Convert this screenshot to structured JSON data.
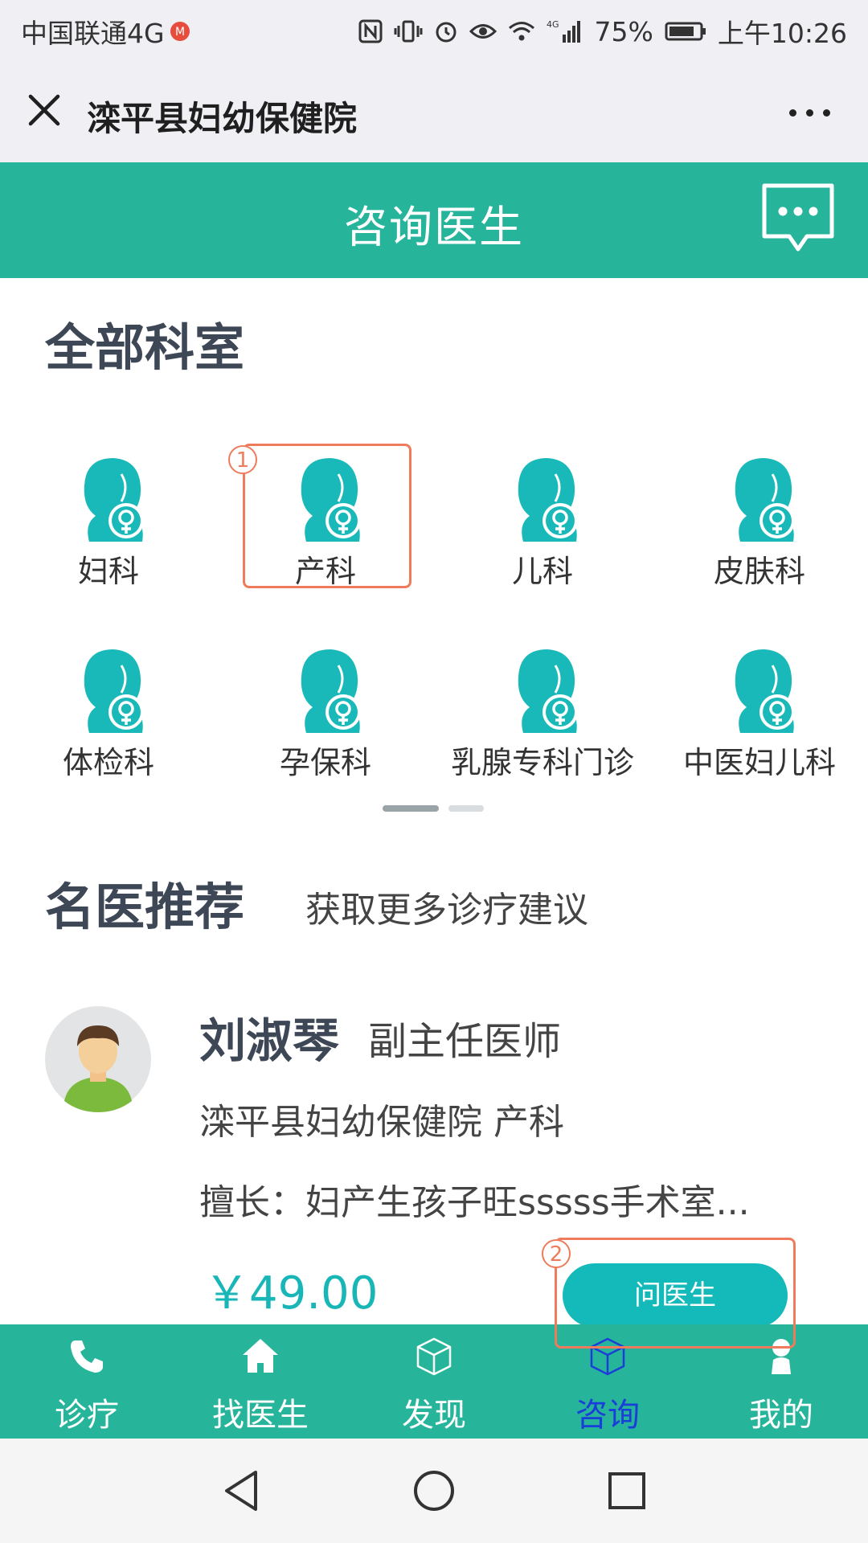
{
  "status_bar": {
    "carrier": "中国联通4G",
    "battery": "75%",
    "time": "上午10:26"
  },
  "title_bar": {
    "title": "滦平县妇幼保健院"
  },
  "header": {
    "title": "咨询医生"
  },
  "departments_section": {
    "title": "全部科室",
    "items": [
      {
        "label": "妇科"
      },
      {
        "label": "产科"
      },
      {
        "label": "儿科"
      },
      {
        "label": "皮肤科"
      },
      {
        "label": "体检科"
      },
      {
        "label": "孕保科"
      },
      {
        "label": "乳腺专科门诊"
      },
      {
        "label": "中医妇儿科"
      }
    ]
  },
  "recommend_section": {
    "title": "名医推荐",
    "subtitle": "获取更多诊疗建议"
  },
  "doctor": {
    "name": "刘淑琴",
    "title": "副主任医师",
    "hospital": "滦平县妇幼保健院 产科",
    "skill": "擅长：妇产生孩子旺sssss手术室...",
    "price": "￥49.00",
    "ask_button": "问医生"
  },
  "annotations": {
    "badge1": "1",
    "badge2": "2"
  },
  "tabs": [
    {
      "label": "诊疗",
      "icon": "phone-icon"
    },
    {
      "label": "找医生",
      "icon": "home-icon"
    },
    {
      "label": "发现",
      "icon": "cube-icon"
    },
    {
      "label": "咨询",
      "icon": "cube-icon",
      "active": true
    },
    {
      "label": "我的",
      "icon": "person-icon"
    }
  ],
  "colors": {
    "primary": "#26b59b",
    "accent_teal": "#13bab9",
    "active_tab": "#1a3fd8",
    "annotation": "#ee7c5c"
  }
}
